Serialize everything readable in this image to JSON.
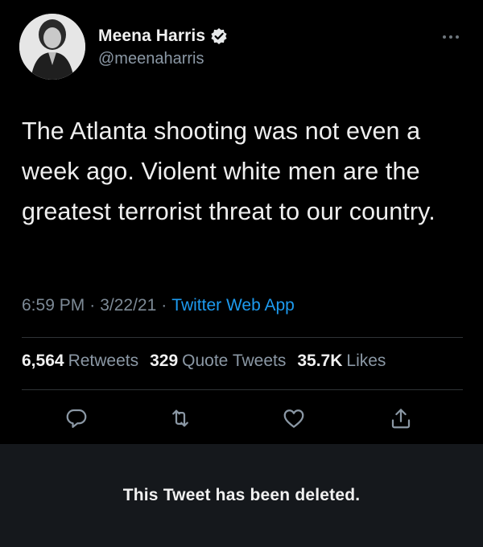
{
  "author": {
    "display_name": "Meena Harris",
    "handle": "@meenaharris",
    "verified": true,
    "avatar_icon": "profile-photo"
  },
  "tweet": {
    "text": "The Atlanta shooting was not even a week ago. Violent white men are the greatest terrorist threat to our country.",
    "time": "6:59 PM",
    "date": "3/22/21",
    "separator": "·",
    "source": "Twitter Web App"
  },
  "stats": {
    "retweets": {
      "value": "6,564",
      "label": "Retweets"
    },
    "quote_tweets": {
      "value": "329",
      "label": "Quote Tweets"
    },
    "likes": {
      "value": "35.7K",
      "label": "Likes"
    }
  },
  "actions": [
    "reply-icon",
    "retweet-icon",
    "like-icon",
    "share-icon"
  ],
  "deleted_notice": "This Tweet has been deleted.",
  "colors": {
    "background": "#000000",
    "link": "#1d9bf0",
    "secondary_text": "#8b98a5",
    "notice_bar": "#15181c"
  }
}
